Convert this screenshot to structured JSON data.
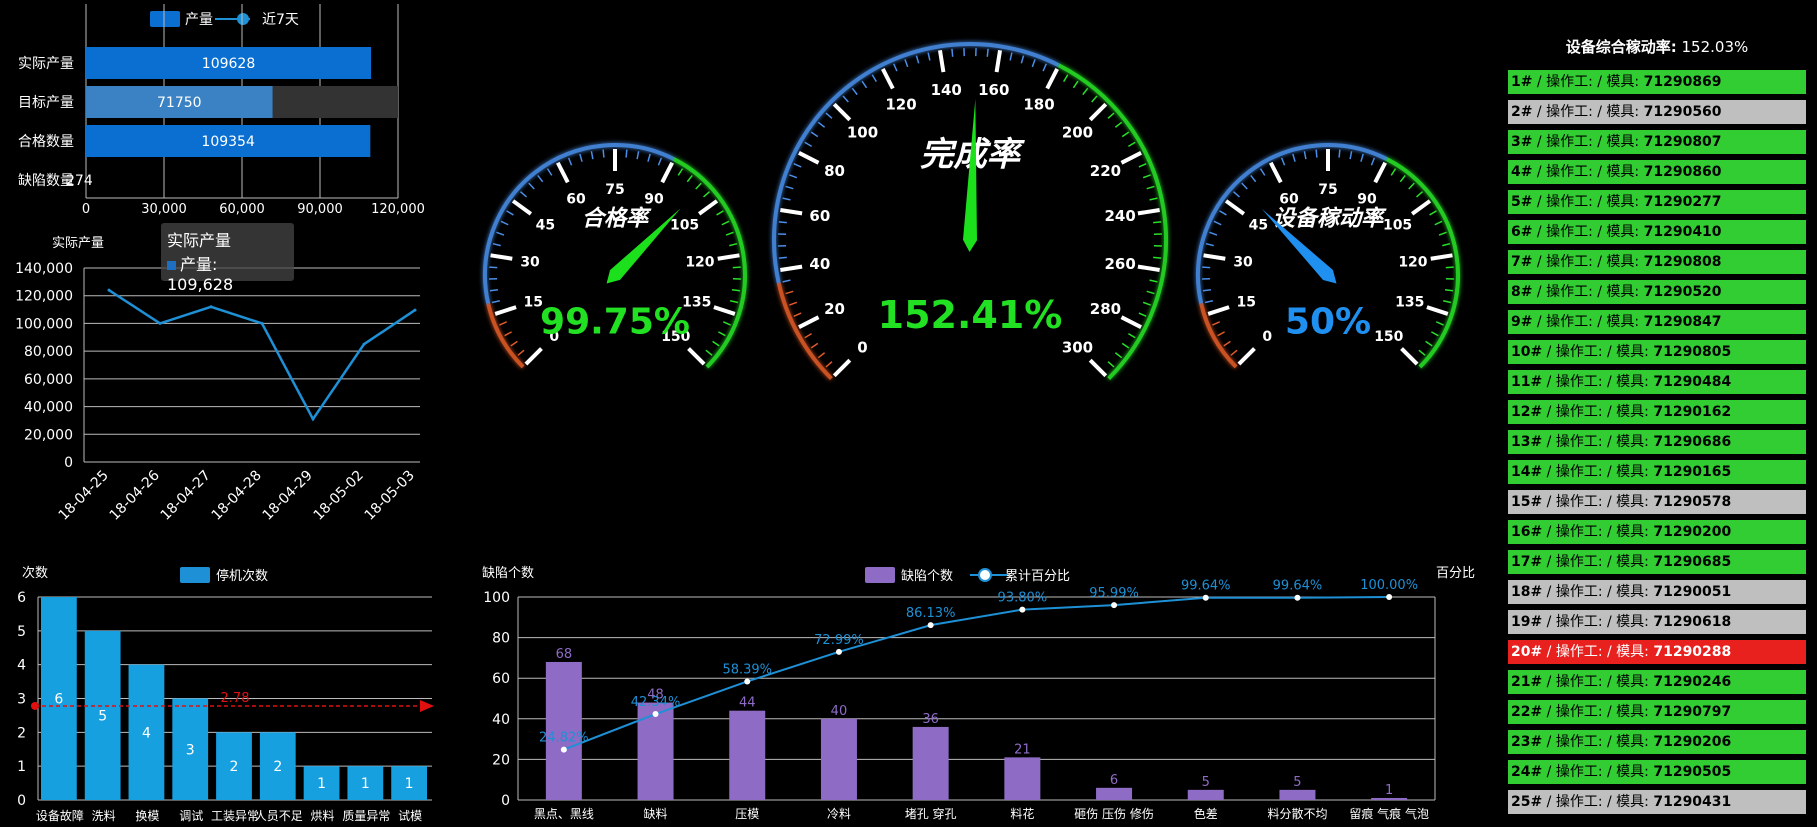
{
  "bar_top": {
    "legend": [
      "产量",
      "近7天"
    ],
    "categories": [
      "实际产量",
      "目标产量",
      "合格数量",
      "缺陷数量"
    ],
    "values": [
      109628,
      71750,
      109354,
      274
    ],
    "value_labels": [
      "109628",
      "71750",
      "109354",
      "274"
    ],
    "xticks": [
      "0",
      "30,000",
      "60,000",
      "90,000",
      "120,000"
    ],
    "xmax": 120000
  },
  "line_chart": {
    "title": "实际产量",
    "categories": [
      "18-04-25",
      "18-04-26",
      "18-04-27",
      "18-04-28",
      "18-04-29",
      "18-05-02",
      "18-05-03"
    ],
    "values": [
      124000,
      100000,
      112000,
      100000,
      31000,
      85000,
      109628
    ],
    "yticks": [
      "0",
      "20,000",
      "40,000",
      "60,000",
      "80,000",
      "100,000",
      "120,000",
      "140,000"
    ],
    "ymax": 140000,
    "tooltip_title": "实际产量",
    "tooltip_value": "产量: 109,628"
  },
  "gauges": {
    "left": {
      "title": "合格率",
      "value": "99.75%",
      "ticks": [
        "0",
        "15",
        "30",
        "45",
        "60",
        "75",
        "90",
        "105",
        "120",
        "135",
        "150"
      ],
      "max": 150,
      "reading": 99.75
    },
    "center": {
      "title": "完成率",
      "value": "152.41%",
      "ticks": [
        "0",
        "20",
        "40",
        "60",
        "80",
        "100",
        "120",
        "140",
        "160",
        "180",
        "200",
        "220",
        "240",
        "260",
        "280",
        "300"
      ],
      "max": 300,
      "reading": 152.41
    },
    "right": {
      "title": "设备稼动率",
      "value": "50%",
      "ticks": [
        "0",
        "15",
        "30",
        "45",
        "60",
        "75",
        "90",
        "105",
        "120",
        "135",
        "150"
      ],
      "max": 150,
      "reading": 50
    }
  },
  "downtime_chart": {
    "ylabel": "次数",
    "legend": "停机次数",
    "categories": [
      "设备故障",
      "洗料",
      "换模",
      "调试",
      "工装异常",
      "人员不足",
      "烘料",
      "质量异常",
      "试模"
    ],
    "values": [
      6,
      5,
      4,
      3,
      2,
      2,
      1,
      1,
      1
    ],
    "yticks": [
      "0",
      "1",
      "2",
      "3",
      "4",
      "5",
      "6"
    ],
    "ymax": 6,
    "avg_label": "2.78",
    "avg": 2.78
  },
  "pareto_chart": {
    "ylabel": "缺陷个数",
    "y2label": "百分比",
    "legend": [
      "缺陷个数",
      "累计百分比"
    ],
    "categories": [
      "黑点、黑线",
      "缺料",
      "压模",
      "冷料",
      "堵孔 穿孔",
      "料花",
      "砸伤 压伤 修伤",
      "色差",
      "料分散不均",
      "留痕 气痕 气泡"
    ],
    "values": [
      68,
      48,
      44,
      40,
      36,
      21,
      6,
      5,
      5,
      1
    ],
    "cumulative": [
      24.82,
      42.34,
      58.39,
      72.99,
      86.13,
      93.8,
      95.99,
      99.64,
      99.64,
      100.0
    ],
    "cumulative_labels": [
      "24.82%",
      "42.34%",
      "58.39%",
      "72.99%",
      "86.13%",
      "93.80%",
      "95.99%",
      "99.64%",
      "99.64%",
      "100.00%"
    ],
    "yticks": [
      "0",
      "20",
      "40",
      "60",
      "80",
      "100"
    ],
    "ymax": 100
  },
  "oee": {
    "label": "设备综合稼动率:",
    "value": "152.03%"
  },
  "machines": [
    {
      "id": "1#",
      "mold": "71290869",
      "status": "green"
    },
    {
      "id": "2#",
      "mold": "71290560",
      "status": "gray"
    },
    {
      "id": "3#",
      "mold": "71290807",
      "status": "green"
    },
    {
      "id": "4#",
      "mold": "71290860",
      "status": "green"
    },
    {
      "id": "5#",
      "mold": "71290277",
      "status": "green"
    },
    {
      "id": "6#",
      "mold": "71290410",
      "status": "green"
    },
    {
      "id": "7#",
      "mold": "71290808",
      "status": "green"
    },
    {
      "id": "8#",
      "mold": "71290520",
      "status": "green"
    },
    {
      "id": "9#",
      "mold": "71290847",
      "status": "green"
    },
    {
      "id": "10#",
      "mold": "71290805",
      "status": "green"
    },
    {
      "id": "11#",
      "mold": "71290484",
      "status": "green"
    },
    {
      "id": "12#",
      "mold": "71290162",
      "status": "green"
    },
    {
      "id": "13#",
      "mold": "71290686",
      "status": "green"
    },
    {
      "id": "14#",
      "mold": "71290165",
      "status": "green"
    },
    {
      "id": "15#",
      "mold": "71290578",
      "status": "gray"
    },
    {
      "id": "16#",
      "mold": "71290200",
      "status": "green"
    },
    {
      "id": "17#",
      "mold": "71290685",
      "status": "green"
    },
    {
      "id": "18#",
      "mold": "71290051",
      "status": "gray"
    },
    {
      "id": "19#",
      "mold": "71290618",
      "status": "gray"
    },
    {
      "id": "20#",
      "mold": "71290288",
      "status": "red"
    },
    {
      "id": "21#",
      "mold": "71290246",
      "status": "green"
    },
    {
      "id": "22#",
      "mold": "71290797",
      "status": "green"
    },
    {
      "id": "23#",
      "mold": "71290206",
      "status": "green"
    },
    {
      "id": "24#",
      "mold": "71290505",
      "status": "green"
    },
    {
      "id": "25#",
      "mold": "71290431",
      "status": "gray"
    }
  ],
  "machine_text": {
    "operator": "/ 操作工:",
    "mold": "/ 模具:"
  },
  "colors": {
    "bar_blue": "#0a6fd0",
    "bar_light": "#3a82c4",
    "line_blue": "#1e90d6",
    "gauge_green": "#22e022",
    "gauge_blue": "#1e8cf0",
    "purple": "#8e6bc5",
    "avg_red": "#e01010"
  }
}
